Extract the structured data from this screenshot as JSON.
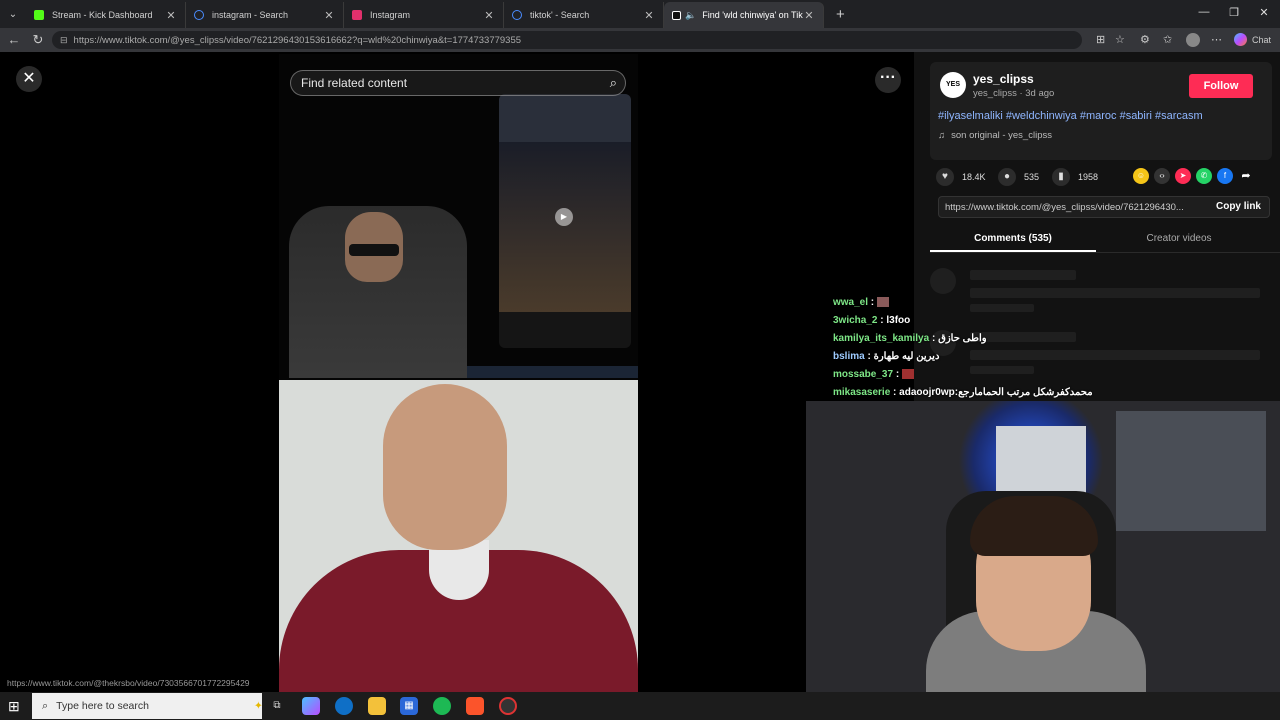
{
  "browser": {
    "tabs": [
      {
        "title": "Stream - Kick Dashboard",
        "icon": "kick-icon",
        "color": "#53fc18"
      },
      {
        "title": "instagram - Search",
        "icon": "search-icon",
        "color": "#4a8cff"
      },
      {
        "title": "Instagram",
        "icon": "instagram-icon",
        "color": "#e1306c"
      },
      {
        "title": "tiktok' - Search",
        "icon": "search-icon",
        "color": "#4a8cff"
      },
      {
        "title": "Find 'wld chinwiya' on TikTok",
        "icon": "tiktok-icon",
        "color": "#ffffff"
      }
    ],
    "new_tab": "+",
    "url": "https://www.tiktok.com/@yes_clipss/video/7621296430153616662?q=wld%20chinwiya&t=1774733779355",
    "chat_label": "Chat"
  },
  "player": {
    "find_placeholder": "Find related content",
    "close": "✕",
    "more": "···"
  },
  "post": {
    "avatar_text": "YES",
    "username": "yes_clipss",
    "subline": "yes_clipss · 3d ago",
    "follow": "Follow",
    "hashtags": "#ilyaselmaliki #weldchinwiya #maroc #sabiri #sarcasm",
    "sound": "son original - yes_clipss",
    "likes": "18.4K",
    "comments": "535",
    "saves": "1958",
    "link": "https://www.tiktok.com/@yes_clipss/video/7621296430...",
    "copy_link": "Copy link",
    "tab_comments": "Comments (535)",
    "tab_creator": "Creator videos"
  },
  "chat": [
    {
      "user": "wwa_el",
      "msg": " : ",
      "blue": false
    },
    {
      "user": "3wicha_2",
      "msg": " : l3foo",
      "blue": false
    },
    {
      "user": "kamilya_its_kamilya",
      "msg": " : واطى حازق",
      "blue": false
    },
    {
      "user": "bslima",
      "msg": " : ديرين ليه طهارة",
      "blue": true
    },
    {
      "user": "mossabe_37",
      "msg": " : ",
      "blue": false
    },
    {
      "user": "mikasaserie",
      "msg": " : adaoojr0wp:محمدكفرشكل مرتب الحمامارجع",
      "blue": false
    }
  ],
  "status_url": "https://www.tiktok.com/@thekrsbo/video/7303566701772295429",
  "taskbar": {
    "search_placeholder": "Type here to search"
  }
}
